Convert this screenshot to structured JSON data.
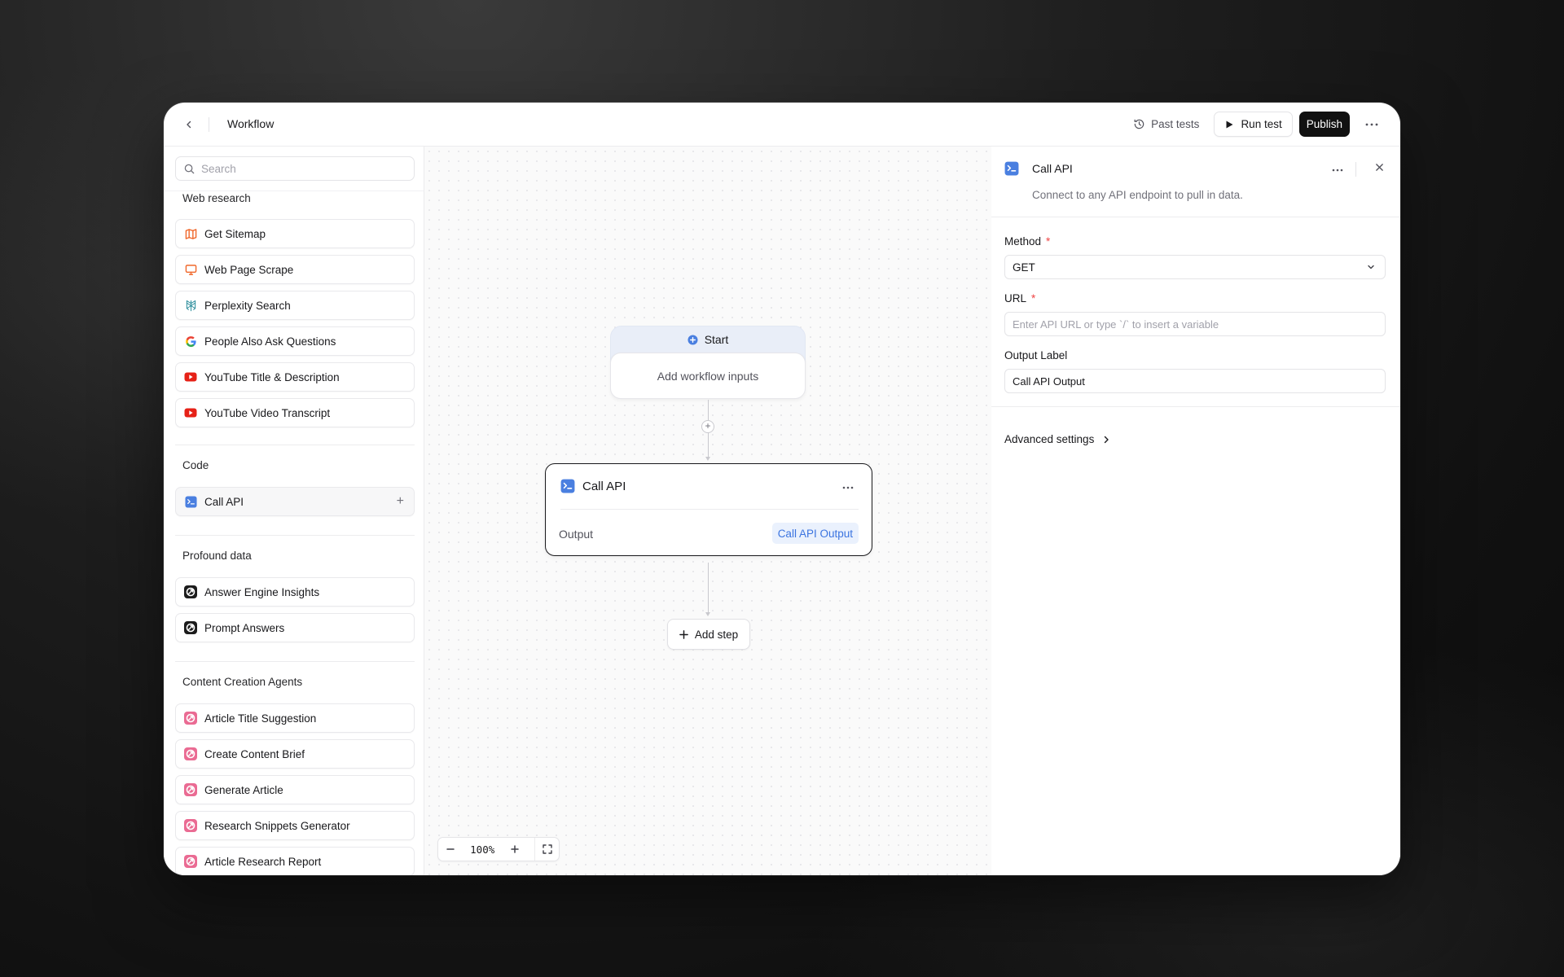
{
  "header": {
    "title": "Workflow",
    "past_tests": "Past tests",
    "run_test": "Run test",
    "publish": "Publish"
  },
  "sidebar": {
    "search_placeholder": "Search",
    "groups": {
      "web_research": {
        "title": "Web research",
        "items": [
          "Get Sitemap",
          "Web Page Scrape",
          "Perplexity Search",
          "People Also Ask Questions",
          "YouTube Title & Description",
          "YouTube Video Transcript"
        ]
      },
      "code": {
        "title": "Code",
        "items": [
          "Call API"
        ]
      },
      "profound_data": {
        "title": "Profound data",
        "items": [
          "Answer Engine Insights",
          "Prompt Answers"
        ]
      },
      "content_creation": {
        "title": "Content Creation Agents",
        "items": [
          "Article Title Suggestion",
          "Create Content Brief",
          "Generate Article",
          "Research Snippets Generator",
          "Article Research Report"
        ]
      }
    }
  },
  "canvas": {
    "start_node": {
      "title": "Start",
      "body": "Add workflow inputs"
    },
    "api_node": {
      "title": "Call API",
      "output_label": "Output",
      "output_chip": "Call API Output"
    },
    "add_step": "Add step",
    "zoom": "100%"
  },
  "panel": {
    "title": "Call API",
    "description": "Connect to any API endpoint to pull in data.",
    "method_label": "Method",
    "method_value": "GET",
    "url_label": "URL",
    "url_placeholder": "Enter API URL or type `/` to insert a variable",
    "output_label": "Output Label",
    "output_value": "Call API Output",
    "advanced": "Advanced settings",
    "required_mark": "*"
  },
  "colors": {
    "accent_blue": "#3b74e0",
    "chip_bg": "#eaf1fd",
    "required": "#ef4444",
    "publish_bg": "#111111"
  }
}
